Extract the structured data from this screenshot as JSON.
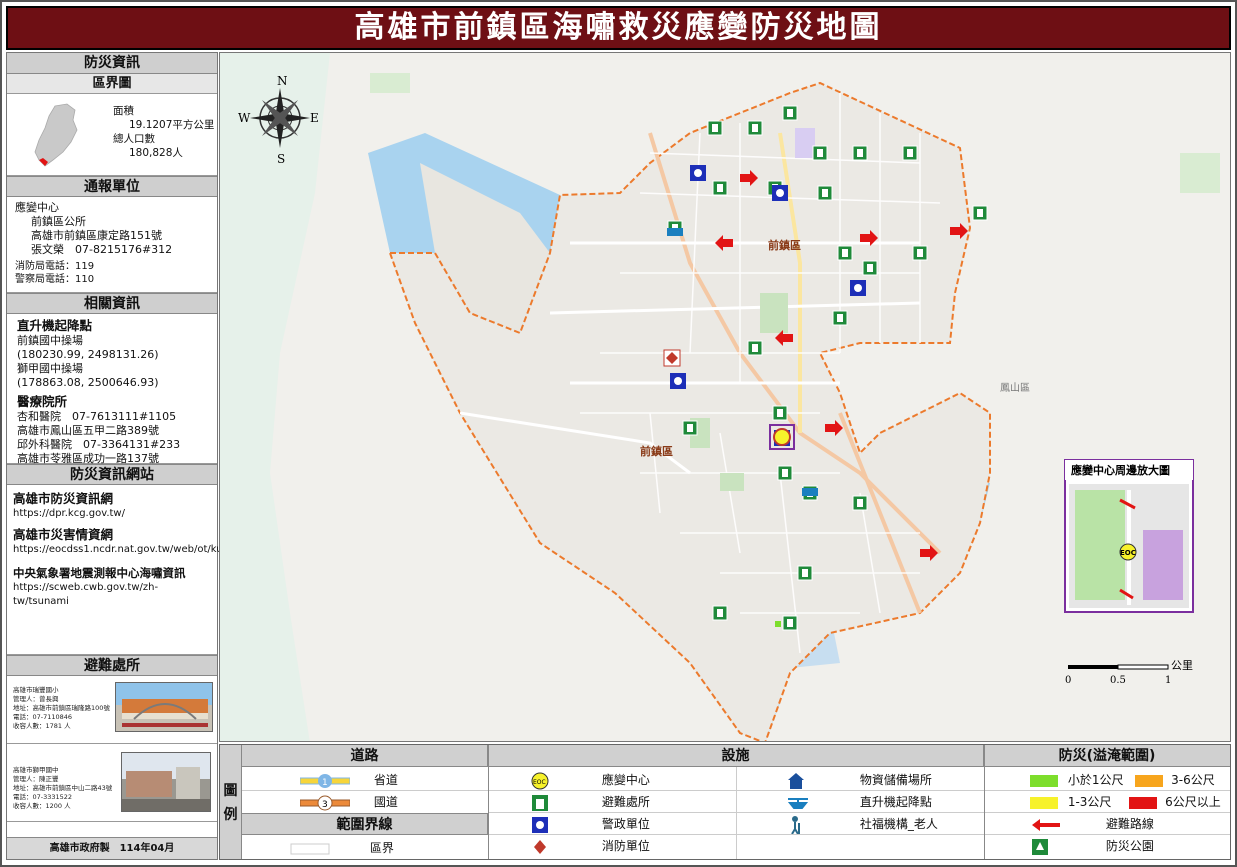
{
  "title": "高雄市前鎮區海嘯救災應變防災地圖",
  "left": {
    "info_heading": "防災資訊",
    "district_heading": "區界圖",
    "area_label": "面積",
    "area_value": "19.1207平方公里",
    "population_label": "總人口數",
    "population_value": "180,828人",
    "report_heading": "通報單位",
    "report_center": "應變中心",
    "report_office": "前鎮區公所",
    "report_address": "高雄市前鎮區康定路151號",
    "report_contact": "張文榮　07-8215176#312",
    "fire_phone": "消防局電話：119",
    "police_phone": "警察局電話：110",
    "related_heading": "相關資訊",
    "heli_title": "直升機起降點",
    "heli_1_name": "前鎮國中操場",
    "heli_1_coord": "(180230.99, 2498131.26)",
    "heli_2_name": "獅甲國中操場",
    "heli_2_coord": "(178863.08, 2500646.93)",
    "hospital_title": "醫療院所",
    "hosp_1": "杏和醫院　07-7613111#1105",
    "hosp_1_addr": "高雄市鳳山區五甲二路389號",
    "hosp_2": "邱外科醫院　07-3364131#233",
    "hosp_2_addr": "高雄市苓雅區成功一路137號",
    "web_heading": "防災資訊網站",
    "web_1_title": "高雄市防災資訊網",
    "web_1_url": "https://dpr.kcg.gov.tw/",
    "web_2_title": "高雄市災害情資網",
    "web_2_url": "https://eocdss1.ncdr.nat.gov.tw/web/ot/ku",
    "web_3_title": "中央氣象署地震測報中心海嘯資訊",
    "web_3_url": "https://scweb.cwb.gov.tw/zh-tw/tsunami",
    "shelter_heading": "避難處所",
    "shelter_1": [
      "高雄市瑞豐國小",
      "管理人：曾長興",
      "地址：高雄市前鎮區瑞隆路100號",
      "電話：07-7110846",
      "收容人數：1781 人"
    ],
    "shelter_2": [
      "高雄市獅甲國中",
      "管理人：陳正豐",
      "地址：高雄市前鎮區中山二路43號",
      "電話：07-3331522",
      "收容人數：1200 人"
    ],
    "footer": "高雄市政府製　114年04月"
  },
  "map": {
    "compass": {
      "n": "N",
      "s": "S",
      "e": "E",
      "w": "W"
    },
    "district_label_1": "前鎮區",
    "district_label_2": "前鎮區",
    "district_label_3": "鳳山區",
    "inset_title": "應變中心周邊放大圖",
    "eoc_label": "EOC",
    "scale_unit": "公里",
    "scale_ticks": [
      "0",
      "0.5",
      "1"
    ]
  },
  "legend": {
    "side_label_1": "圖",
    "side_label_2": "例",
    "roads_heading": "道路",
    "facilities_heading": "設施",
    "disaster_heading": "防災(溢淹範圍)",
    "boundary_heading": "範圍界線",
    "provincial": "省道",
    "national": "國道",
    "boundary": "區界",
    "eoc": "應變中心",
    "shelter": "避難處所",
    "police": "警政單位",
    "fire": "消防單位",
    "supply": "物資儲備場所",
    "heli": "直升機起降點",
    "welfare": "社福機構_老人",
    "flood_1": "小於1公尺",
    "flood_2": "3-6公尺",
    "flood_3": "1-3公尺",
    "flood_4": "6公尺以上",
    "evac_route": "避難路線",
    "disaster_park": "防災公園",
    "hwy_num_1": "1",
    "hwy_num_2": "3"
  },
  "colors": {
    "title_bg": "#6e0f14",
    "water": "#a9d3ef",
    "flood_lt1": "#7dde2c",
    "flood_1_3": "#f7f22b",
    "flood_3_6": "#f7a51d",
    "flood_gt6": "#e21414",
    "boundary": "#ec7a2c",
    "shelter_green": "#1f8a3a",
    "police_blue": "#1d2fb8"
  }
}
